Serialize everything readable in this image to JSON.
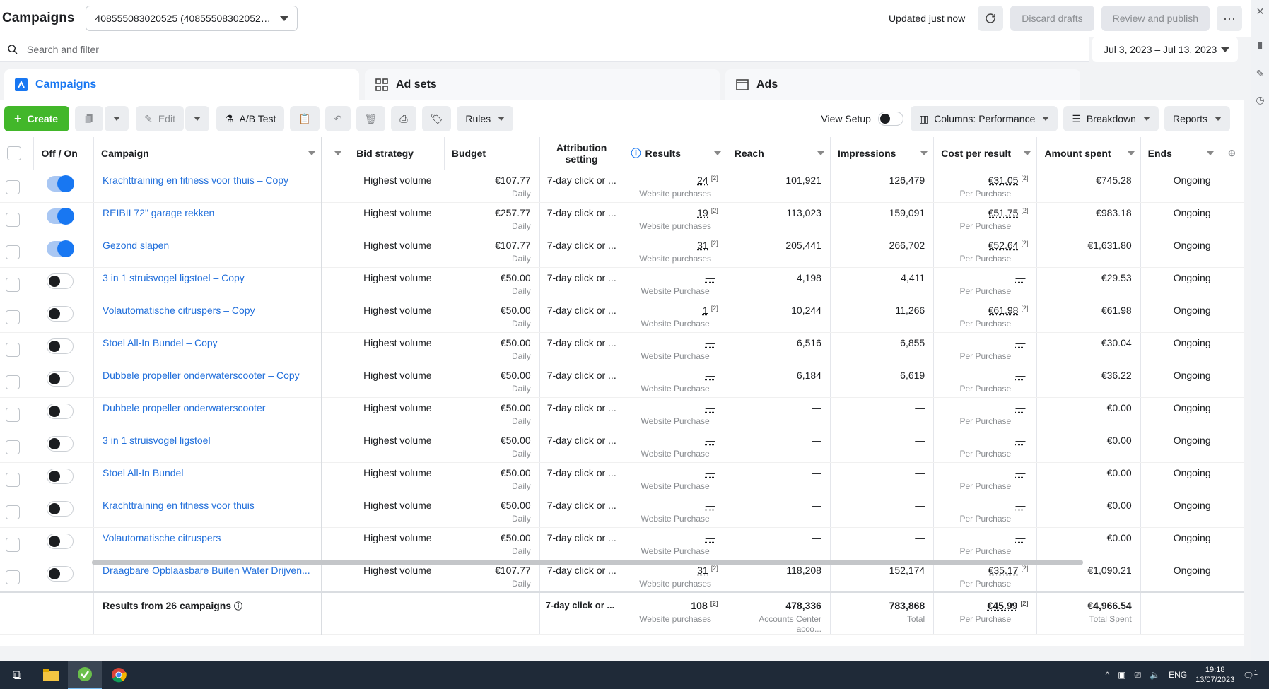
{
  "header": {
    "title": "Campaigns",
    "account": "408555083020525 (40855508302052…",
    "updated": "Updated just now",
    "discard": "Discard drafts",
    "review": "Review and publish",
    "more": "···"
  },
  "search": {
    "placeholder": "Search and filter",
    "date_range": "Jul 3, 2023 – Jul 13, 2023"
  },
  "tabs": [
    {
      "label": "Campaigns"
    },
    {
      "label": "Ad sets"
    },
    {
      "label": "Ads"
    }
  ],
  "toolbar": {
    "create": "Create",
    "edit": "Edit",
    "ab_test": "A/B Test",
    "rules": "Rules",
    "view_setup": "View Setup",
    "columns": "Columns: Performance",
    "breakdown": "Breakdown",
    "reports": "Reports"
  },
  "columns": [
    "Off / On",
    "Campaign",
    "Bid strategy",
    "Budget",
    "Attribution setting",
    "Results",
    "Reach",
    "Impressions",
    "Cost per result",
    "Amount spent",
    "Ends"
  ],
  "rows": [
    {
      "on": true,
      "name": "Krachttraining en fitness voor thuis – Copy",
      "bid": "Highest volume",
      "budget": "€107.77",
      "budget_sub": "Daily",
      "attr": "7-day click or ...",
      "results": "24",
      "results_sup": "[2]",
      "results_sub": "Website purchases",
      "reach": "101,921",
      "impr": "126,479",
      "cpr": "€31.05",
      "cpr_sup": "[2]",
      "cpr_sub": "Per Purchase",
      "spent": "€745.28",
      "ends": "Ongoing"
    },
    {
      "on": true,
      "name": "REIBII 72\" garage rekken",
      "bid": "Highest volume",
      "budget": "€257.77",
      "budget_sub": "Daily",
      "attr": "7-day click or ...",
      "results": "19",
      "results_sup": "[2]",
      "results_sub": "Website purchases",
      "reach": "113,023",
      "impr": "159,091",
      "cpr": "€51.75",
      "cpr_sup": "[2]",
      "cpr_sub": "Per Purchase",
      "spent": "€983.18",
      "ends": "Ongoing"
    },
    {
      "on": true,
      "name": "Gezond slapen",
      "bid": "Highest volume",
      "budget": "€107.77",
      "budget_sub": "Daily",
      "attr": "7-day click or ...",
      "results": "31",
      "results_sup": "[2]",
      "results_sub": "Website purchases",
      "reach": "205,441",
      "impr": "266,702",
      "cpr": "€52.64",
      "cpr_sup": "[2]",
      "cpr_sub": "Per Purchase",
      "spent": "€1,631.80",
      "ends": "Ongoing"
    },
    {
      "on": false,
      "name": "3 in 1 struisvogel ligstoel – Copy",
      "bid": "Highest volume",
      "budget": "€50.00",
      "budget_sub": "Daily",
      "attr": "7-day click or ...",
      "results": "—",
      "results_sup": "",
      "results_sub": "Website Purchase",
      "reach": "4,198",
      "impr": "4,411",
      "cpr": "—",
      "cpr_sup": "",
      "cpr_sub": "Per Purchase",
      "spent": "€29.53",
      "ends": "Ongoing"
    },
    {
      "on": false,
      "name": "Volautomatische citruspers – Copy",
      "bid": "Highest volume",
      "budget": "€50.00",
      "budget_sub": "Daily",
      "attr": "7-day click or ...",
      "results": "1",
      "results_sup": "[2]",
      "results_sub": "Website Purchase",
      "reach": "10,244",
      "impr": "11,266",
      "cpr": "€61.98",
      "cpr_sup": "[2]",
      "cpr_sub": "Per Purchase",
      "spent": "€61.98",
      "ends": "Ongoing"
    },
    {
      "on": false,
      "name": "Stoel All-In Bundel – Copy",
      "bid": "Highest volume",
      "budget": "€50.00",
      "budget_sub": "Daily",
      "attr": "7-day click or ...",
      "results": "—",
      "results_sup": "",
      "results_sub": "Website Purchase",
      "reach": "6,516",
      "impr": "6,855",
      "cpr": "—",
      "cpr_sup": "",
      "cpr_sub": "Per Purchase",
      "spent": "€30.04",
      "ends": "Ongoing"
    },
    {
      "on": false,
      "name": "Dubbele propeller onderwaterscooter – Copy",
      "bid": "Highest volume",
      "budget": "€50.00",
      "budget_sub": "Daily",
      "attr": "7-day click or ...",
      "results": "—",
      "results_sup": "",
      "results_sub": "Website Purchase",
      "reach": "6,184",
      "impr": "6,619",
      "cpr": "—",
      "cpr_sup": "",
      "cpr_sub": "Per Purchase",
      "spent": "€36.22",
      "ends": "Ongoing"
    },
    {
      "on": false,
      "name": "Dubbele propeller onderwaterscooter",
      "bid": "Highest volume",
      "budget": "€50.00",
      "budget_sub": "Daily",
      "attr": "7-day click or ...",
      "results": "—",
      "results_sup": "",
      "results_sub": "Website Purchase",
      "reach": "—",
      "impr": "—",
      "cpr": "—",
      "cpr_sup": "",
      "cpr_sub": "Per Purchase",
      "spent": "€0.00",
      "ends": "Ongoing"
    },
    {
      "on": false,
      "name": "3 in 1 struisvogel ligstoel",
      "bid": "Highest volume",
      "budget": "€50.00",
      "budget_sub": "Daily",
      "attr": "7-day click or ...",
      "results": "—",
      "results_sup": "",
      "results_sub": "Website Purchase",
      "reach": "—",
      "impr": "—",
      "cpr": "—",
      "cpr_sup": "",
      "cpr_sub": "Per Purchase",
      "spent": "€0.00",
      "ends": "Ongoing"
    },
    {
      "on": false,
      "name": "Stoel All-In Bundel",
      "bid": "Highest volume",
      "budget": "€50.00",
      "budget_sub": "Daily",
      "attr": "7-day click or ...",
      "results": "—",
      "results_sup": "",
      "results_sub": "Website Purchase",
      "reach": "—",
      "impr": "—",
      "cpr": "—",
      "cpr_sup": "",
      "cpr_sub": "Per Purchase",
      "spent": "€0.00",
      "ends": "Ongoing"
    },
    {
      "on": false,
      "name": "Krachttraining en fitness voor thuis",
      "bid": "Highest volume",
      "budget": "€50.00",
      "budget_sub": "Daily",
      "attr": "7-day click or ...",
      "results": "—",
      "results_sup": "",
      "results_sub": "Website Purchase",
      "reach": "—",
      "impr": "—",
      "cpr": "—",
      "cpr_sup": "",
      "cpr_sub": "Per Purchase",
      "spent": "€0.00",
      "ends": "Ongoing"
    },
    {
      "on": false,
      "name": "Volautomatische citruspers",
      "bid": "Highest volume",
      "budget": "€50.00",
      "budget_sub": "Daily",
      "attr": "7-day click or ...",
      "results": "—",
      "results_sup": "",
      "results_sub": "Website Purchase",
      "reach": "—",
      "impr": "—",
      "cpr": "—",
      "cpr_sup": "",
      "cpr_sub": "Per Purchase",
      "spent": "€0.00",
      "ends": "Ongoing"
    },
    {
      "on": false,
      "name": "Draagbare Opblaasbare Buiten Water Drijven...",
      "bid": "Highest volume",
      "budget": "€107.77",
      "budget_sub": "Daily",
      "attr": "7-day click or ...",
      "results": "31",
      "results_sup": "[2]",
      "results_sub": "Website purchases",
      "reach": "118,208",
      "impr": "152,174",
      "cpr": "€35.17",
      "cpr_sup": "[2]",
      "cpr_sub": "Per Purchase",
      "spent": "€1,090.21",
      "ends": "Ongoing"
    }
  ],
  "footer": {
    "label": "Results from 26 campaigns",
    "attr": "7-day click or ...",
    "results": "108",
    "results_sup": "[2]",
    "results_sub": "Website purchases",
    "reach": "478,336",
    "reach_sub": "Accounts Center acco...",
    "impr": "783,868",
    "impr_sub": "Total",
    "cpr": "€45.99",
    "cpr_sup": "[2]",
    "cpr_sub": "Per Purchase",
    "spent": "€4,966.54",
    "spent_sub": "Total Spent"
  },
  "taskbar": {
    "lang": "ENG",
    "time": "19:18",
    "date": "13/07/2023",
    "notif": "1"
  },
  "colors": {
    "accent": "#1877f2",
    "create": "#42b72a",
    "link": "#216fdb"
  }
}
